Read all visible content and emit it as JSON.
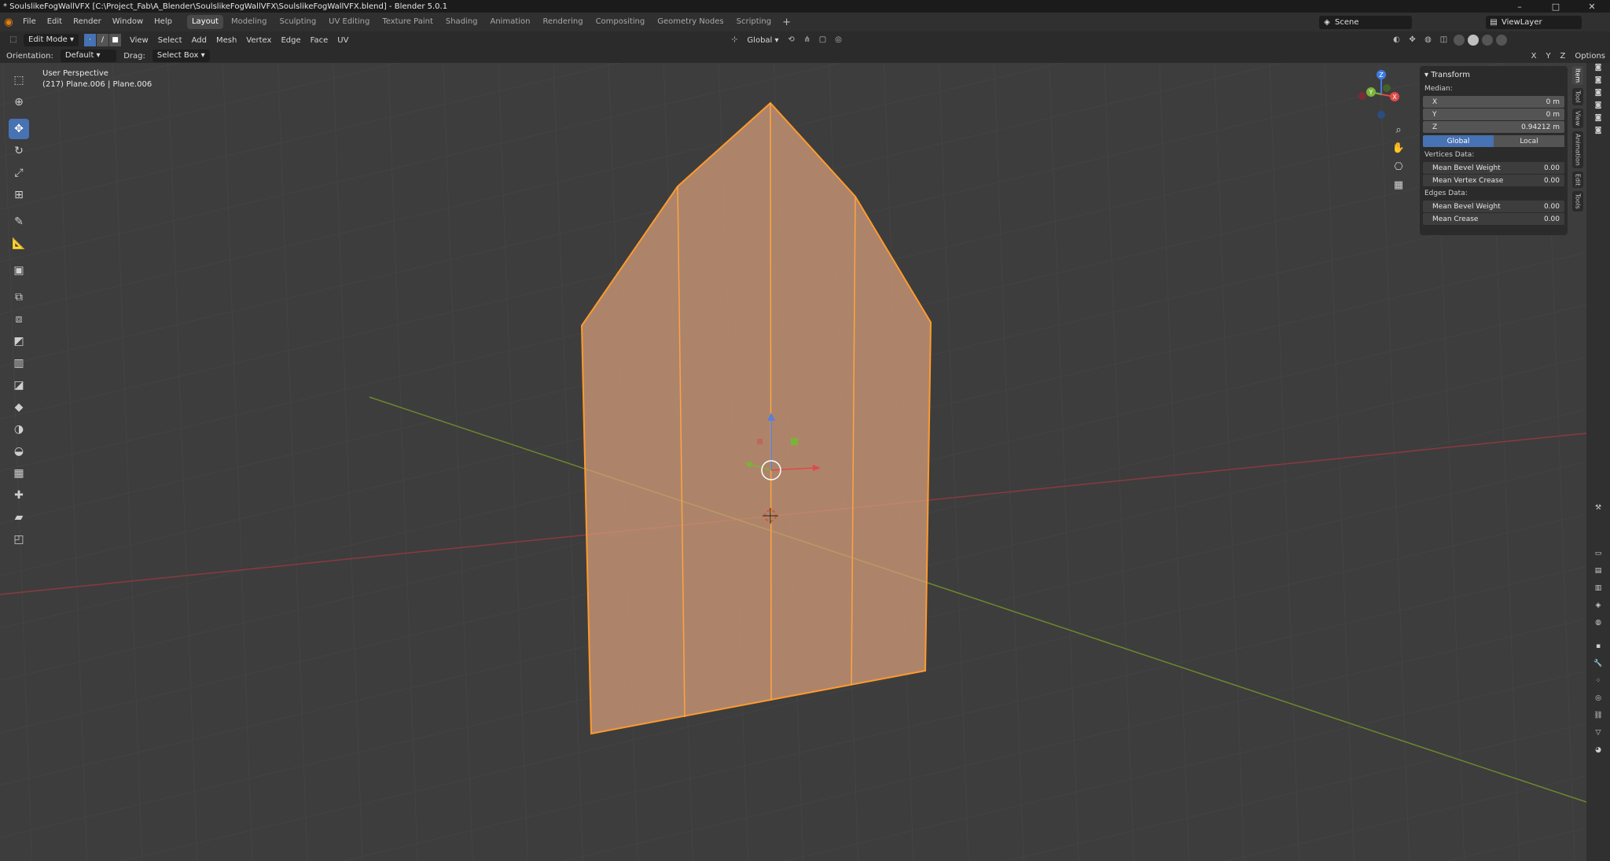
{
  "window": {
    "title": "* SoulslikeFogWallVFX [C:\\Project_Fab\\A_Blender\\SoulslikeFogWallVFX\\SoulslikeFogWallVFX.blend] - Blender 5.0.1",
    "minimize": "–",
    "maximize": "□",
    "close": "✕"
  },
  "menu": [
    "File",
    "Edit",
    "Render",
    "Window",
    "Help"
  ],
  "workspaces": [
    "Layout",
    "Modeling",
    "Sculpting",
    "UV Editing",
    "Texture Paint",
    "Shading",
    "Animation",
    "Rendering",
    "Compositing",
    "Geometry Nodes",
    "Scripting"
  ],
  "active_workspace": "Layout",
  "add_workspace": "+",
  "scene": "Scene",
  "view_layer": "ViewLayer",
  "header": {
    "mode": "Edit Mode",
    "menus": [
      "View",
      "Select",
      "Add",
      "Mesh",
      "Vertex",
      "Edge",
      "Face",
      "UV"
    ],
    "transform_orientation": "Global",
    "options": "Options"
  },
  "header2": {
    "orientation_label": "Orientation:",
    "orientation_value": "Default",
    "drag_label": "Drag:",
    "drag_value": "Select Box",
    "axes": [
      "X",
      "Y",
      "Z"
    ]
  },
  "viewport": {
    "perspective": "User Perspective",
    "object_info": "(217) Plane.006 | Plane.006"
  },
  "gizmo": {
    "x": "X",
    "y": "Y",
    "z": "Z"
  },
  "npanel": {
    "section": "Transform",
    "median_label": "Median:",
    "median": [
      {
        "axis": "X",
        "value": "0 m"
      },
      {
        "axis": "Y",
        "value": "0 m"
      },
      {
        "axis": "Z",
        "value": "0.94212 m"
      }
    ],
    "space_global": "Global",
    "space_local": "Local",
    "vertices_label": "Vertices Data:",
    "vertices": [
      {
        "name": "Mean Bevel Weight",
        "value": "0.00"
      },
      {
        "name": "Mean Vertex Crease",
        "value": "0.00"
      }
    ],
    "edges_label": "Edges Data:",
    "edges": [
      {
        "name": "Mean Bevel Weight",
        "value": "0.00"
      },
      {
        "name": "Mean Crease",
        "value": "0.00"
      }
    ]
  },
  "side_tabs": [
    "Item",
    "Tool",
    "View",
    "Animation",
    "Edit",
    "Tools"
  ],
  "colors": {
    "accent": "#4772b3",
    "selection": "#ffa033",
    "x_axis": "#ff3352",
    "y_axis": "#8bdc00",
    "z_axis": "#2890ff"
  }
}
